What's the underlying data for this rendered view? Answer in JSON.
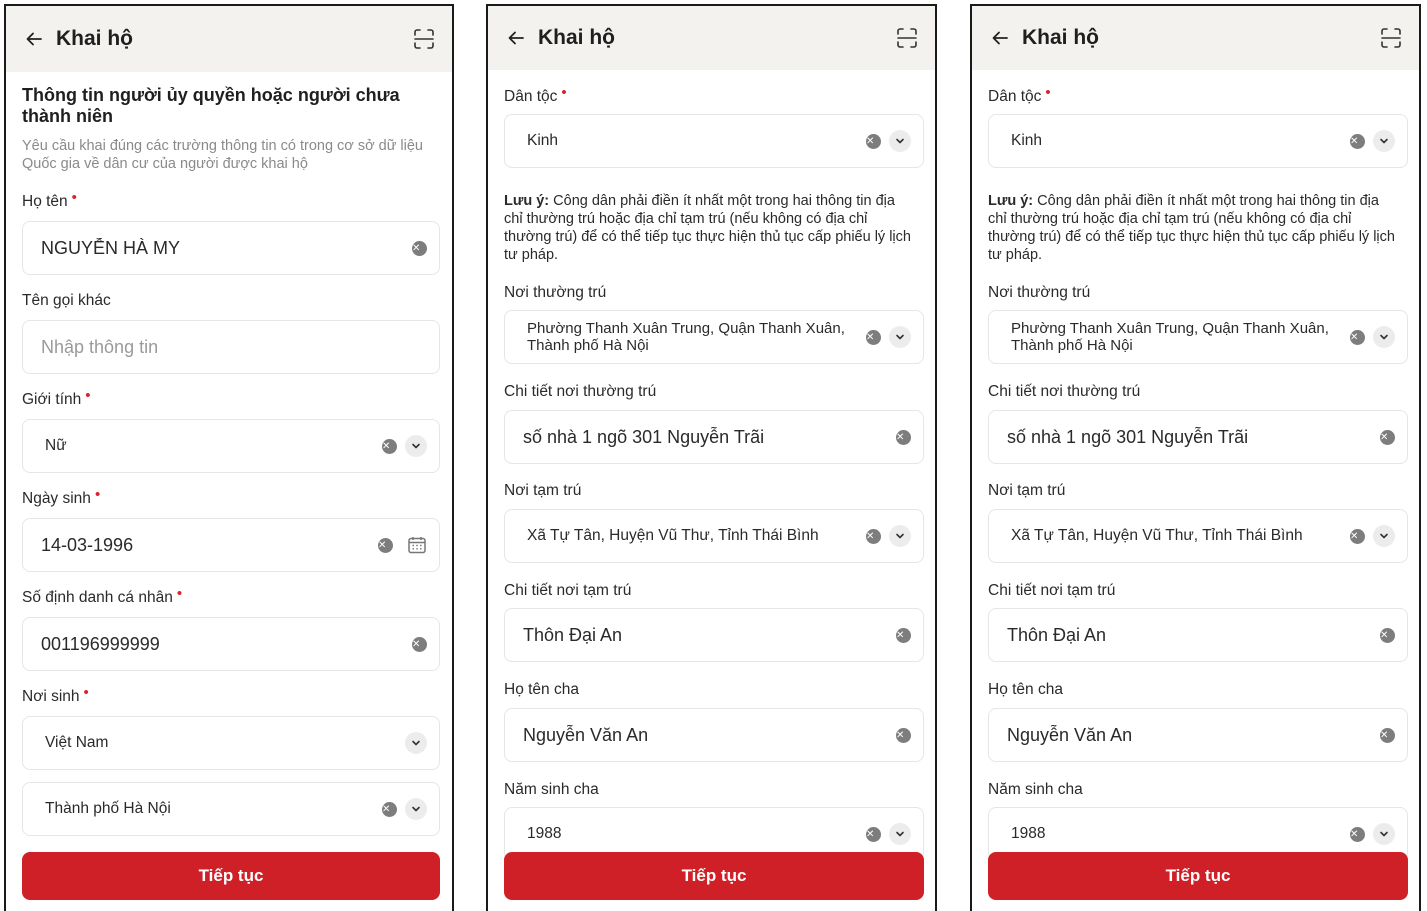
{
  "screen1": {
    "header": {
      "title": "Khai hộ"
    },
    "section_title": "Thông tin người ủy quyền hoặc người chưa thành niên",
    "hint": "Yêu cầu khai đúng các trường thông tin có trong cơ sở dữ liệu Quốc gia về dân cư của người được khai hộ",
    "fields": {
      "ho_ten": {
        "label": "Họ tên",
        "value": "NGUYỄN HÀ MY"
      },
      "ten_goi_khac": {
        "label": "Tên gọi khác",
        "placeholder": "Nhập thông tin"
      },
      "gioi_tinh": {
        "label": "Giới tính",
        "value": "Nữ"
      },
      "ngay_sinh": {
        "label": "Ngày sinh",
        "value": "14-03-1996"
      },
      "so_dinh_danh": {
        "label": "Số định danh cá nhân",
        "value": "001196999999"
      },
      "noi_sinh": {
        "label": "Nơi sinh",
        "country": "Việt Nam",
        "province": "Thành phố Hà Nội"
      }
    },
    "button": "Tiếp tục"
  },
  "screen2": {
    "header": {
      "title": "Khai hộ"
    },
    "fields": {
      "dan_toc": {
        "label": "Dân tộc",
        "value": "Kinh"
      },
      "note_bold": "Lưu ý:",
      "note_text": " Công dân phải điền ít nhất một trong hai thông tin địa chỉ thường trú hoặc địa chỉ tạm trú (nếu không có địa chỉ thường trú) để có thể tiếp tục thực hiện thủ tục cấp phiếu lý lịch tư pháp.",
      "noi_thuong_tru": {
        "label": "Nơi thường trú",
        "value": "Phường Thanh Xuân Trung, Quận Thanh Xuân, Thành phố Hà Nội"
      },
      "chi_tiet_thuong_tru": {
        "label": "Chi tiết nơi thường trú",
        "value": "số nhà 1 ngõ 301 Nguyễn Trãi"
      },
      "noi_tam_tru": {
        "label": "Nơi tạm trú",
        "value": "Xã Tự Tân, Huyện Vũ Thư, Tỉnh Thái Bình"
      },
      "chi_tiet_tam_tru": {
        "label": "Chi tiết nơi tạm trú",
        "value": "Thôn Đại An"
      },
      "ho_ten_cha": {
        "label": "Họ tên cha",
        "value": "Nguyễn Văn An"
      },
      "nam_sinh_cha": {
        "label": "Năm sinh cha",
        "value": "1988"
      }
    },
    "button": "Tiếp tục"
  },
  "screen3": {
    "header": {
      "title": "Khai hộ"
    },
    "fields": {
      "dan_toc": {
        "label": "Dân tộc",
        "value": "Kinh"
      },
      "note_bold": "Lưu ý:",
      "note_text": " Công dân phải điền ít nhất một trong hai thông tin địa chỉ thường trú hoặc địa chỉ tạm trú (nếu không có địa chỉ thường trú) để có thể tiếp tục thực hiện thủ tục cấp phiếu lý lịch tư pháp.",
      "noi_thuong_tru": {
        "label": "Nơi thường trú",
        "value": "Phường Thanh Xuân Trung, Quận Thanh Xuân, Thành phố Hà Nội"
      },
      "chi_tiet_thuong_tru": {
        "label": "Chi tiết nơi thường trú",
        "value": "số nhà 1 ngõ 301 Nguyễn Trãi"
      },
      "noi_tam_tru": {
        "label": "Nơi tạm trú",
        "value": "Xã Tự Tân, Huyện Vũ Thư, Tỉnh Thái Bình"
      },
      "chi_tiet_tam_tru": {
        "label": "Chi tiết nơi tạm trú",
        "value": "Thôn Đại An"
      },
      "ho_ten_cha": {
        "label": "Họ tên cha",
        "value": "Nguyễn Văn An"
      },
      "nam_sinh_cha": {
        "label": "Năm sinh cha",
        "value": "1988"
      }
    },
    "button": "Tiếp tục"
  },
  "icons": [
    "back-arrow-icon",
    "scan-icon",
    "clear-icon",
    "chevron-down-icon",
    "calendar-icon"
  ],
  "colors": {
    "accent": "#d02027",
    "required": "#d8232a",
    "header_bg": "#f4f2ef"
  }
}
